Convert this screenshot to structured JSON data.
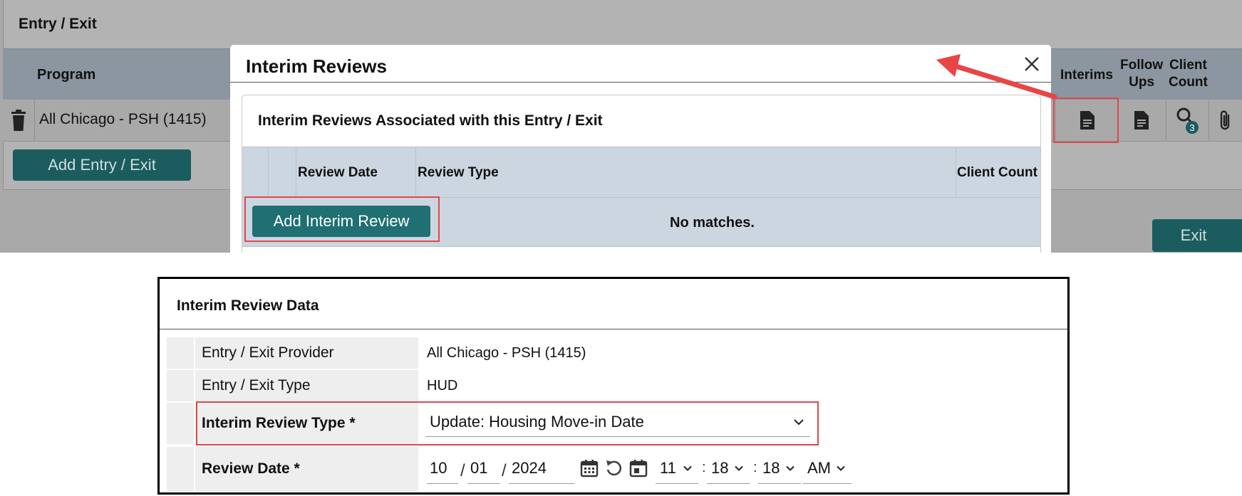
{
  "background": {
    "title": "Entry / Exit",
    "columns": {
      "program": "Program",
      "interims": "Interims",
      "follow_ups_1": "Follow",
      "follow_ups_2": "Ups",
      "client_count_1": "Client",
      "client_count_2": "Count"
    },
    "row": {
      "program": "All Chicago - PSH (1415)",
      "client_count_badge": "3"
    },
    "add_button": "Add Entry / Exit",
    "exit_button": "Exit"
  },
  "modal": {
    "title": "Interim Reviews",
    "panel_title": "Interim Reviews Associated with this Entry / Exit",
    "columns": [
      "Review Date",
      "Review Type",
      "Client Count"
    ],
    "add_button": "Add Interim Review",
    "empty_text": "No matches."
  },
  "form": {
    "title": "Interim Review Data",
    "rows": {
      "provider_label": "Entry / Exit Provider",
      "provider_value": "All Chicago - PSH (1415)",
      "type_label": "Entry / Exit Type",
      "type_value": "HUD",
      "review_type_label": "Interim Review Type *",
      "review_type_value": "Update: Housing Move-in Date",
      "review_date_label": "Review Date *"
    },
    "date": {
      "month": "10",
      "day": "01",
      "year": "2024",
      "sep": "/"
    },
    "time": {
      "hour": "11",
      "minute": "18",
      "second": "18",
      "ampm": "AM",
      "colon": ":"
    }
  },
  "colors": {
    "teal": "#1f6f73",
    "highlight": "#e04848",
    "header_blue": "#ccd6e0"
  },
  "icons": [
    "trash-icon",
    "document-icon",
    "search-icon",
    "paperclip-icon",
    "close-icon",
    "calendar-icon",
    "reset-icon",
    "chevron-down-icon"
  ]
}
